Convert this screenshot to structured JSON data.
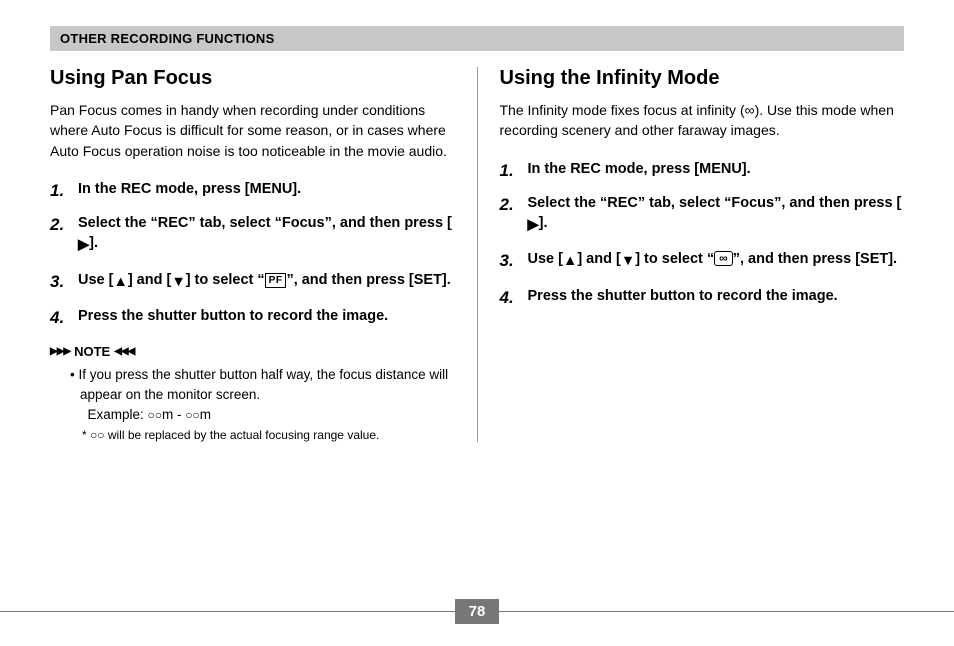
{
  "header": "OTHER RECORDING FUNCTIONS",
  "left": {
    "title": "Using Pan Focus",
    "intro": "Pan Focus comes in handy when recording under conditions where Auto Focus is difficult for some reason, or in cases where Auto Focus operation noise is too noticeable in the movie audio.",
    "steps": {
      "s1": "In the REC mode, press [MENU].",
      "s2a": "Select the “REC” tab, select “Focus”, and then press [",
      "s2b": "].",
      "s3a": "Use [",
      "s3b": "] and [",
      "s3c": "] to select “",
      "s3pf": "PF",
      "s3d": "”, and then press [SET].",
      "s4": "Press the shutter button to record the image."
    },
    "note": {
      "label": "NOTE",
      "pre": "▶▶▶",
      "post": "◀◀◀",
      "body1": "• If you press the shutter button half way, the focus distance will appear on the monitor screen.",
      "body2": "Example: ",
      "oo": "○○",
      "body3": "m - ",
      "body4": "m",
      "foot": "* ○○ will be replaced by the actual focusing range value."
    }
  },
  "right": {
    "title": "Using the Infinity Mode",
    "intro1": "The Infinity mode fixes focus at infinity (",
    "introInf": "∞",
    "intro2": "). Use this mode when recording scenery and other faraway images.",
    "steps": {
      "s1": "In the REC mode, press [MENU].",
      "s2a": "Select the “REC” tab, select “Focus”, and then press [",
      "s2b": "].",
      "s3a": "Use [",
      "s3b": "] and [",
      "s3c": "] to select “",
      "s3inf": "∞",
      "s3d": "”, and then press [SET].",
      "s4": "Press the shutter button to record the image."
    }
  },
  "glyphs": {
    "right": "▶",
    "up": "▲",
    "down": "▼"
  },
  "pageNumber": "78"
}
